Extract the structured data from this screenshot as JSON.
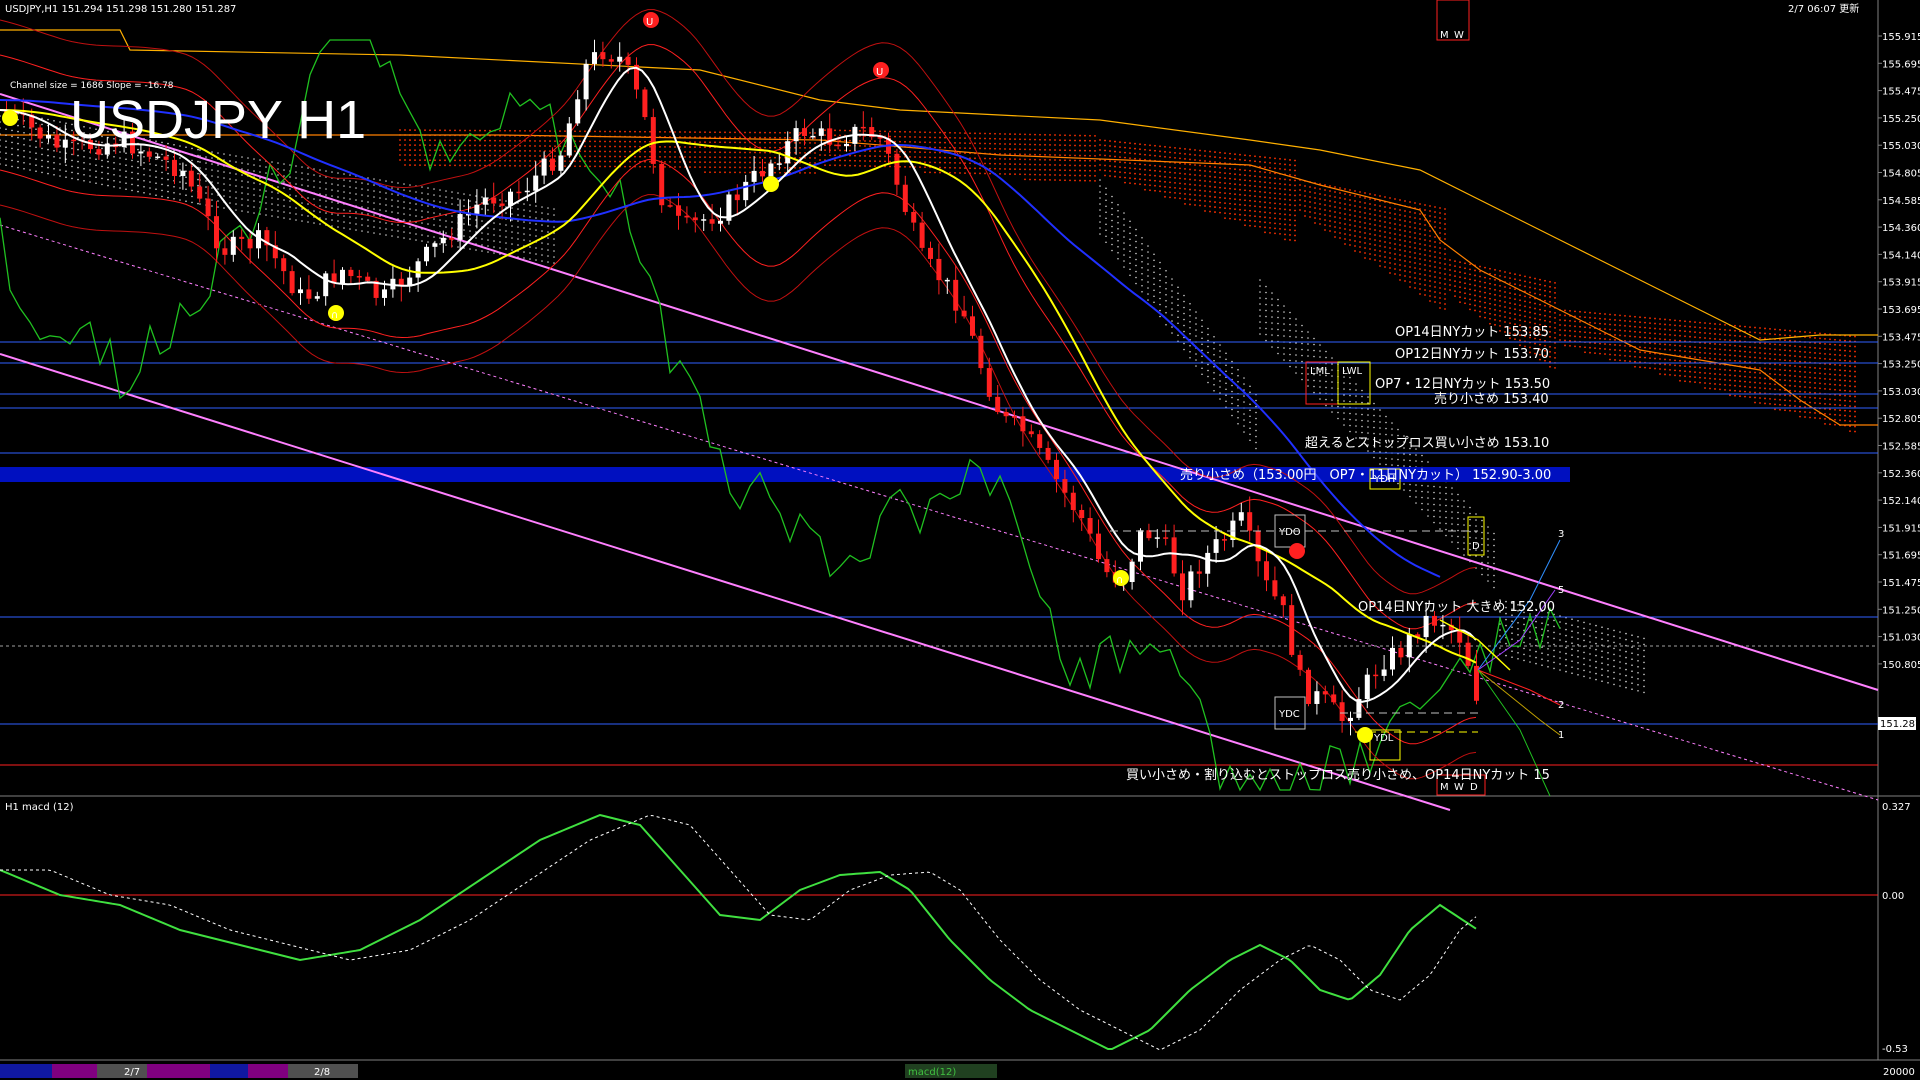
{
  "header": {
    "symbol_info": "USDJPY,H1  151.294 151.298 151.280 151.287",
    "channel_info": "Channel size = 1686 Slope = -16.78",
    "timestamp": "2/7 06:07 更新",
    "big_title": "USDJPY H1"
  },
  "price_axis": {
    "labels": [
      "155.915",
      "155.695",
      "155.475",
      "155.250",
      "155.030",
      "154.805",
      "154.585",
      "154.360",
      "154.140",
      "153.915",
      "153.695",
      "153.475",
      "153.250",
      "153.030",
      "152.805",
      "152.585",
      "152.360",
      "152.140",
      "151.915",
      "151.695",
      "151.475",
      "151.250",
      "151.030",
      "150.805"
    ],
    "current_price": "151.287"
  },
  "macd_axis": {
    "labels": [
      "0.327",
      "0.00",
      "-0.53"
    ],
    "bottom_label": "20000"
  },
  "macd_panel": {
    "label": "H1  macd (12)"
  },
  "annotations": {
    "line_153_85": "OP14日NYカット 153.85",
    "line_153_70": "OP12日NYカット 153.70",
    "line_153_50": "OP7・12日NYカット 153.50",
    "line_153_40": "売り小さめ 153.40",
    "line_153_10": "超えるとストップロス買い小さめ 153.10",
    "band_153": "売り小さめ（153.00円　OP7・11日NYカット） 152.90-3.00",
    "line_152": "OP14日NYカット 大きめ 152.00",
    "bottom_note": "買い小さめ・割り込むとストップロス売り小さめ、OP14日NYカット 15"
  },
  "box_labels": {
    "ydo": "YDO",
    "ydc": "YDC",
    "ydl": "YDL",
    "ydh": "YDH",
    "d": "D",
    "lml": "LML",
    "lwl": "LWL",
    "m": "M",
    "w": "W"
  },
  "wave_labels": {
    "w1": "1",
    "w2": "2",
    "w3": "3",
    "w5": "5"
  },
  "bottom_bar": {
    "date1": "2/7",
    "date2": "2/8",
    "center_label": "macd(12)"
  },
  "colors": {
    "background": "#000000",
    "bull_candle": "#ffffff",
    "bear_candle": "#ff2020",
    "ma_fast": "#ffffff",
    "ma_mid": "#ffff00",
    "ma_slow": "#2030ff",
    "channel": "#ff80ff",
    "lagging_span": "#20c020",
    "horizontal_line": "#3060ff",
    "highlight_band": "#0010c0"
  }
}
